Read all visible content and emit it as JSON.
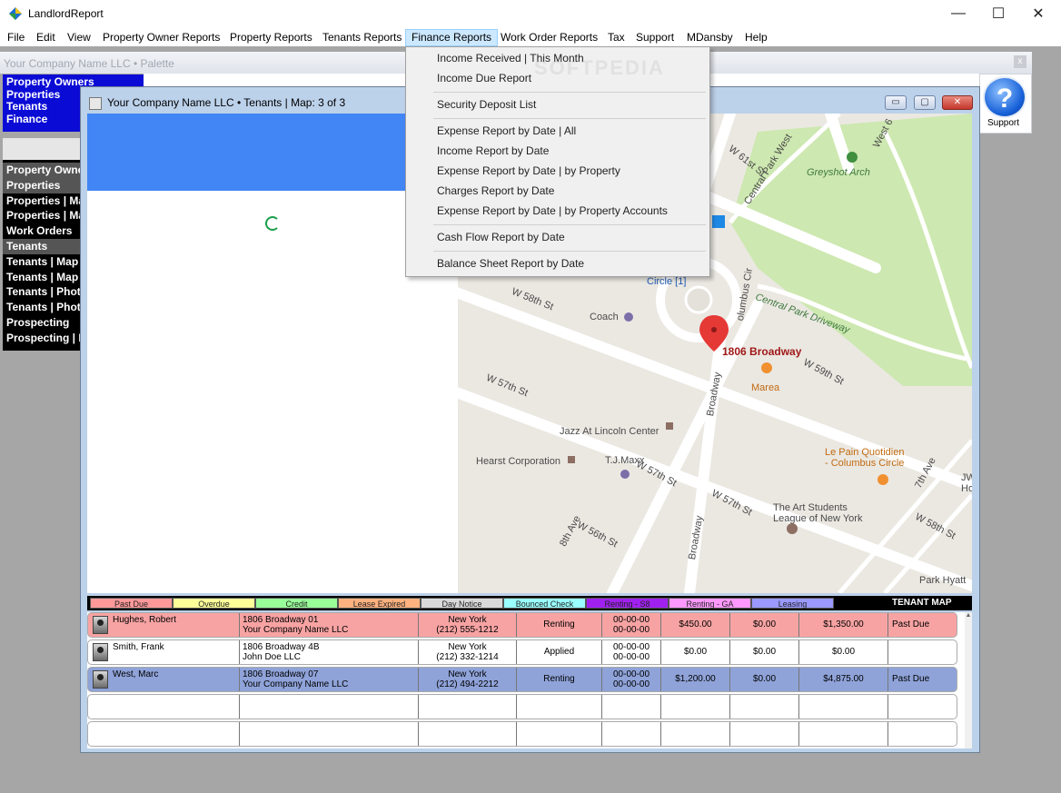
{
  "app": {
    "title": "LandlordReport",
    "window_controls": {
      "minimize": "—",
      "maximize": "☐",
      "close": "✕"
    }
  },
  "menu": [
    {
      "id": "file",
      "label": "File"
    },
    {
      "id": "edit",
      "label": "Edit"
    },
    {
      "id": "view",
      "label": "View"
    },
    {
      "id": "owner_reports",
      "label": "Property Owner Reports"
    },
    {
      "id": "property_reports",
      "label": "Property Reports"
    },
    {
      "id": "tenants_reports",
      "label": "Tenants Reports"
    },
    {
      "id": "finance_reports",
      "label": "Finance Reports"
    },
    {
      "id": "work_order_reports",
      "label": "Work Order Reports"
    },
    {
      "id": "tax",
      "label": "Tax"
    },
    {
      "id": "support",
      "label": "Support"
    },
    {
      "id": "mdansby",
      "label": "MDansby"
    },
    {
      "id": "help",
      "label": "Help"
    }
  ],
  "finance_menu": [
    "Income Received | This Month",
    "Income Due Report",
    "Security Deposit List",
    "Expense Report by Date | All",
    "Income Report by Date",
    "Expense Report by Date | by Property",
    "Charges Report by Date",
    "Expense Report by Date | by Property Accounts",
    "Cash Flow Report by Date",
    "Balance Sheet Report by Date"
  ],
  "palette": {
    "title": "Your Company Name LLC  •  Palette",
    "close": "x"
  },
  "support_button": {
    "icon": "?",
    "label": "Support"
  },
  "nav_top": [
    "Property Owners",
    "Properties",
    "Tenants",
    "Finance"
  ],
  "nav_list": [
    "Property Owners",
    "Properties",
    "Properties | Map",
    "Properties | Map",
    "Work Orders",
    "Tenants",
    "Tenants | Map",
    "Tenants | Map",
    "Tenants | Photo",
    "Tenants | Photo",
    "Prospecting",
    "Prospecting | Map"
  ],
  "child_window": {
    "title": "Your Company Name LLC  •  Tenants | Map: 3 of 3",
    "controls": {
      "minimize": "▭",
      "restore": "▢",
      "close": "✕"
    }
  },
  "map": {
    "pin_label": "1806 Broadway",
    "places": [
      "W 61st St",
      "Central Park West",
      "West 6",
      "Greyshot Arch",
      "Circle [1]",
      "Central Park Driveway",
      "olumbus Cir",
      "W 58th St",
      "Coach",
      "W 59th St",
      "Marea",
      "W 57th St",
      "Broadway",
      "Jazz At Lincoln Center",
      "Hearst Corporation",
      "T.J.Maxx",
      "W 57th St",
      "W 57th St",
      "Le Pain Quotidien",
      "- Columbus Circle",
      "7th Ave",
      "The Art Students",
      "League of New York",
      "8th Ave",
      "W 56th St",
      "W 58th St",
      "Broadway",
      "Park Hyatt",
      "JW",
      "Ho"
    ]
  },
  "legend": {
    "items": [
      {
        "label": "Past Due",
        "color": "#ff9999"
      },
      {
        "label": "Overdue",
        "color": "#ffff99"
      },
      {
        "label": "Credit",
        "color": "#99ff99"
      },
      {
        "label": "Lease Expired",
        "color": "#ffb27f"
      },
      {
        "label": "Day Notice",
        "color": "#d9d9d9"
      },
      {
        "label": "Bounced Check",
        "color": "#99ffff"
      },
      {
        "label": "Renting - S8",
        "color": "#a020f0"
      },
      {
        "label": "Renting - GA",
        "color": "#ff99ff"
      },
      {
        "label": "Leasing",
        "color": "#9999ff"
      }
    ],
    "title": "TENANT MAP"
  },
  "tenants": [
    {
      "name": "Hughes, Robert",
      "address1": "1806 Broadway 01",
      "address2": "Your Company Name LLC",
      "city": "New York",
      "phone": "(212) 555-1212",
      "status": "Renting",
      "date1": "00-00-00",
      "date2": "00-00-00",
      "rent": "$450.00",
      "deposit": "$0.00",
      "balance": "$1,350.00",
      "flag": "Past Due",
      "row_color": "#f8a3a3"
    },
    {
      "name": "Smith, Frank",
      "address1": "1806 Broadway 4B",
      "address2": "John Doe LLC",
      "city": "New York",
      "phone": "(212) 332-1214",
      "status": "Applied",
      "date1": "00-00-00",
      "date2": "00-00-00",
      "rent": "$0.00",
      "deposit": "$0.00",
      "balance": "$0.00",
      "flag": "",
      "row_color": "#ffffff"
    },
    {
      "name": "West, Marc",
      "address1": "1806 Broadway 07",
      "address2": "Your Company Name LLC",
      "city": "New York",
      "phone": "(212) 494-2212",
      "status": "Renting",
      "date1": "00-00-00",
      "date2": "00-00-00",
      "rent": "$1,200.00",
      "deposit": "$0.00",
      "balance": "$4,875.00",
      "flag": "Past Due",
      "row_color": "#8fa3d9"
    }
  ],
  "watermark": "SOFTPEDIA"
}
